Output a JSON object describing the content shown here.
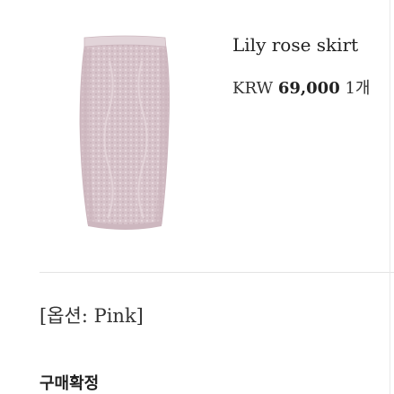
{
  "product": {
    "name": "Lily rose skirt",
    "currency": "KRW",
    "price": "69,000",
    "quantity": "1개",
    "option": "[옵션: Pink]",
    "image_color": "#d9c6cc"
  },
  "actions": {
    "confirm_purchase": "구매확정"
  }
}
